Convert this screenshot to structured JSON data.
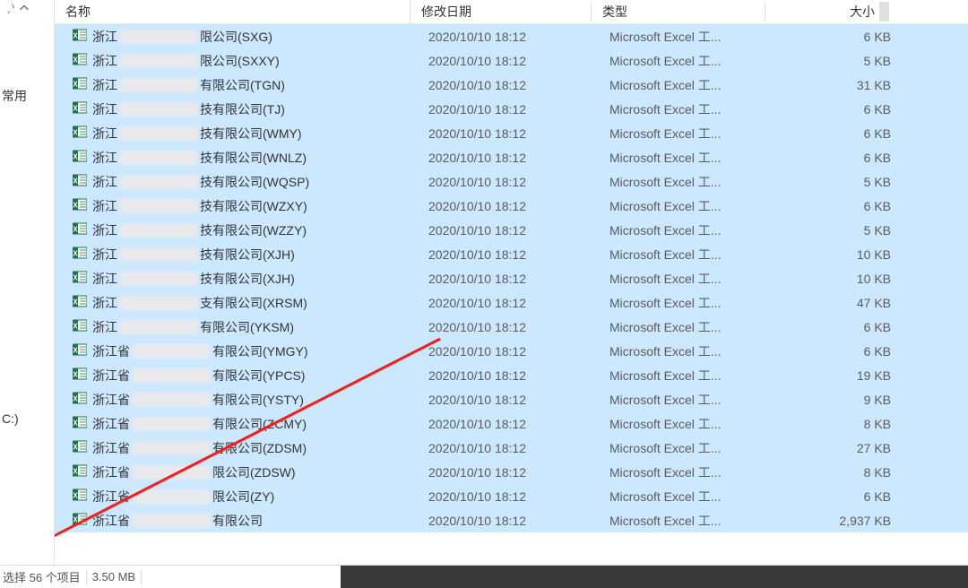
{
  "nav": {
    "favorites_label": "常用",
    "drive_label": "C:)"
  },
  "columns": {
    "name": "名称",
    "date": "修改日期",
    "type": "类型",
    "size": "大小"
  },
  "file_defaults": {
    "date": "2020/10/10 18:12",
    "type": "Microsoft Excel 工..."
  },
  "files": [
    {
      "prefix": "浙江",
      "suffix": "限公司(SXG)",
      "size": "6 KB"
    },
    {
      "prefix": "浙江",
      "suffix": "限公司(SXXY)",
      "size": "5 KB"
    },
    {
      "prefix": "浙江",
      "suffix": "有限公司(TGN)",
      "size": "31 KB"
    },
    {
      "prefix": "浙江",
      "suffix": "技有限公司(TJ)",
      "size": "6 KB"
    },
    {
      "prefix": "浙江",
      "suffix": "技有限公司(WMY)",
      "size": "6 KB"
    },
    {
      "prefix": "浙江",
      "suffix": "技有限公司(WNLZ)",
      "size": "6 KB"
    },
    {
      "prefix": "浙江",
      "suffix": "技有限公司(WQSP)",
      "size": "5 KB"
    },
    {
      "prefix": "浙江",
      "suffix": "技有限公司(WZXY)",
      "size": "6 KB"
    },
    {
      "prefix": "浙江",
      "suffix": "技有限公司(WZZY)",
      "size": "5 KB"
    },
    {
      "prefix": "浙江",
      "suffix": "技有限公司(XJH)",
      "size": "10 KB"
    },
    {
      "prefix": "浙江",
      "suffix": "技有限公司(XJH)",
      "size": "10 KB"
    },
    {
      "prefix": "浙江",
      "suffix": "支有限公司(XRSM)",
      "size": "47 KB"
    },
    {
      "prefix": "浙江",
      "suffix": "有限公司(YKSM)",
      "size": "6 KB"
    },
    {
      "prefix": "浙江省",
      "suffix": "有限公司(YMGY)",
      "size": "6 KB"
    },
    {
      "prefix": "浙江省",
      "suffix": "有限公司(YPCS)",
      "size": "19 KB"
    },
    {
      "prefix": "浙江省",
      "suffix": "有限公司(YSTY)",
      "size": "9 KB"
    },
    {
      "prefix": "浙江省",
      "suffix": "有限公司(ZCMY)",
      "size": "8 KB"
    },
    {
      "prefix": "浙江省",
      "suffix": "有限公司(ZDSM)",
      "size": "27 KB"
    },
    {
      "prefix": "浙江省",
      "suffix": "限公司(ZDSW)",
      "size": "8 KB"
    },
    {
      "prefix": "浙江省",
      "suffix": "限公司(ZY)",
      "size": "6 KB"
    },
    {
      "prefix": "浙江省",
      "suffix": "有限公司",
      "size": "2,937 KB"
    }
  ],
  "status": {
    "selection": "选择 56 个项目",
    "size": "3.50 MB"
  }
}
